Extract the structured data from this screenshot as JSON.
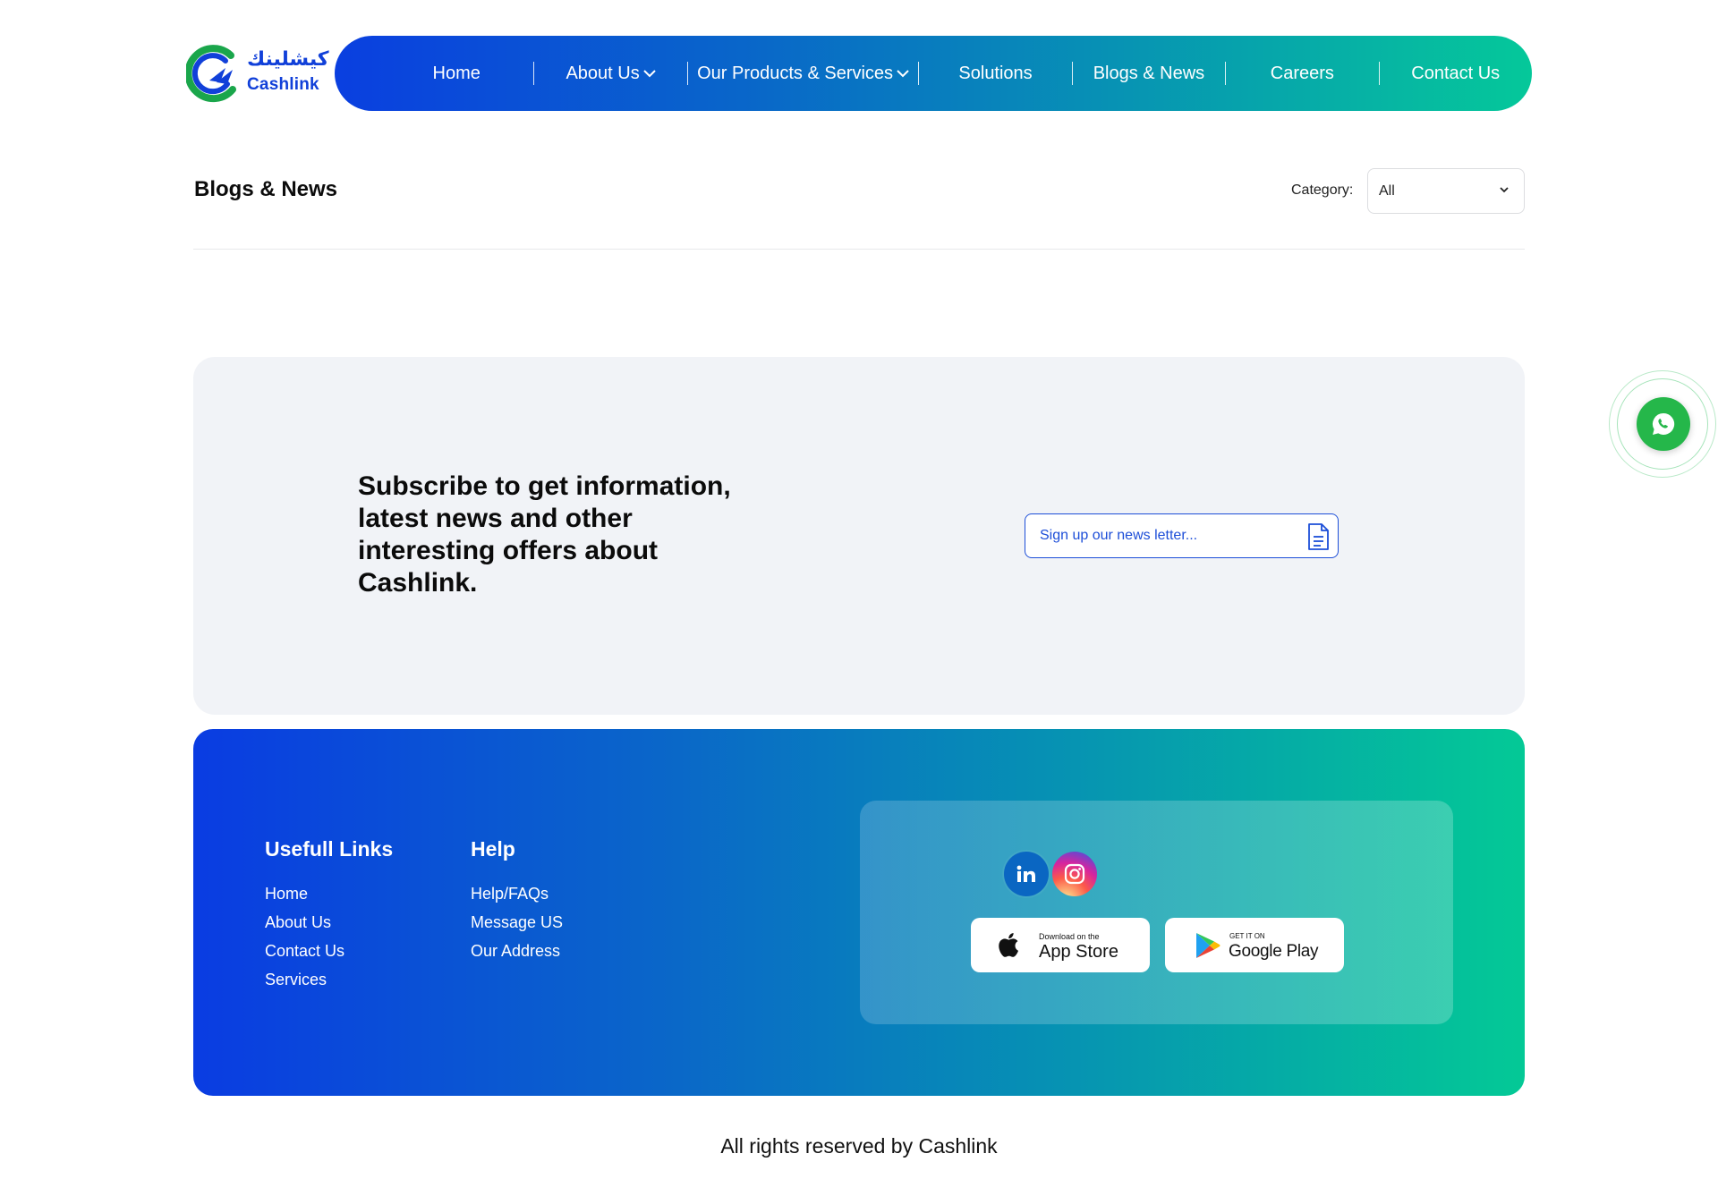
{
  "header": {
    "logo_arabic": "كيشلينك",
    "logo_text": "Cashlink",
    "nav": [
      {
        "label": "Home",
        "has_dropdown": false
      },
      {
        "label": "About Us",
        "has_dropdown": true
      },
      {
        "label": "Our Products & Services",
        "has_dropdown": true
      },
      {
        "label": "Solutions",
        "has_dropdown": false
      },
      {
        "label": "Blogs & News",
        "has_dropdown": false
      },
      {
        "label": "Careers",
        "has_dropdown": false
      },
      {
        "label": "Contact Us",
        "has_dropdown": false
      }
    ]
  },
  "blog": {
    "title": "Blogs & News",
    "category_label": "Category:",
    "category_value": "All"
  },
  "subscribe": {
    "text": "Subscribe to get information, latest news and other interesting offers about Cashlink.",
    "placeholder": "Sign up our news letter..."
  },
  "footer": {
    "useful_links_title": "Usefull Links",
    "useful_links": [
      "Home",
      "About Us",
      "Contact Us",
      "Services"
    ],
    "help_title": "Help",
    "help_links": [
      "Help/FAQs",
      "Message US",
      "Our Address"
    ],
    "social": [
      "linkedin-icon",
      "instagram-icon"
    ],
    "app_store": {
      "small": "Download on the",
      "big": "App Store"
    },
    "google_play": {
      "small": "GET IT ON",
      "big": "Google Play"
    }
  },
  "copyright": "All rights reserved by Cashlink",
  "colors": {
    "brand_blue": "#0a3fe0",
    "brand_green": "#05c89a",
    "whatsapp_green": "#25b74a",
    "subscribe_bg": "#f1f3f7"
  }
}
